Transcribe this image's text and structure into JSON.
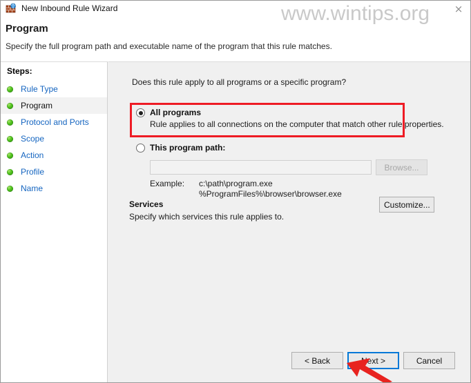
{
  "window": {
    "title": "New Inbound Rule Wizard",
    "icon": "firewall-globe-icon",
    "close_label": "×"
  },
  "header": {
    "title": "Program",
    "subtitle": "Specify the full program path and executable name of the program that this rule matches."
  },
  "sidebar": {
    "label": "Steps:",
    "items": [
      {
        "label": "Rule Type",
        "current": false
      },
      {
        "label": "Program",
        "current": true
      },
      {
        "label": "Protocol and Ports",
        "current": false
      },
      {
        "label": "Scope",
        "current": false
      },
      {
        "label": "Action",
        "current": false
      },
      {
        "label": "Profile",
        "current": false
      },
      {
        "label": "Name",
        "current": false
      }
    ]
  },
  "main": {
    "question": "Does this rule apply to all programs or a specific program?",
    "options": [
      {
        "title": "All programs",
        "description": "Rule applies to all connections on the computer that match other rule properties.",
        "selected": true
      },
      {
        "title": "This program path:",
        "description": "",
        "selected": false
      }
    ],
    "path_input_value": "",
    "path_input_placeholder": "",
    "browse_label": "Browse...",
    "example_label": "Example:",
    "example_values": "c:\\path\\program.exe\n%ProgramFiles%\\browser\\browser.exe",
    "services_title": "Services",
    "services_description": "Specify which services this rule applies to.",
    "customize_label": "Customize..."
  },
  "footer": {
    "back_label": "< Back",
    "next_label": "Next >",
    "cancel_label": "Cancel"
  },
  "overlays": {
    "watermark": "www.wintips.org",
    "highlight_color": "#ee1b24",
    "arrow_color": "#e8231f",
    "focus_color": "#0078d7"
  }
}
